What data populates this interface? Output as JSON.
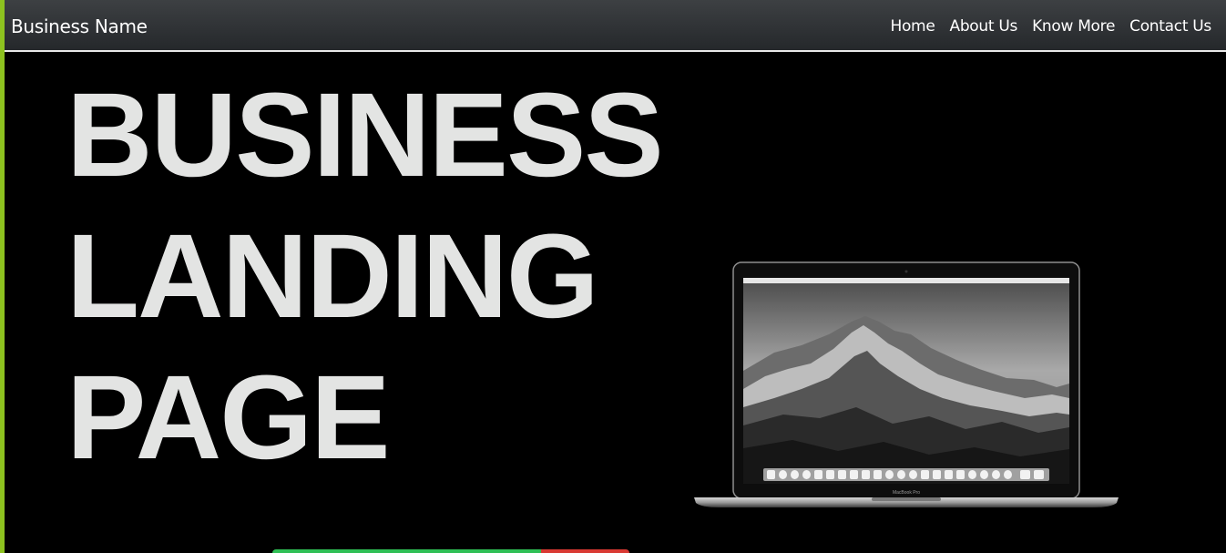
{
  "navbar": {
    "brand": "Business Name",
    "links": [
      "Home",
      "About Us",
      "Know More",
      "Contact Us"
    ]
  },
  "hero": {
    "title_lines": [
      "BUSINESS",
      "LANDING",
      "PAGE"
    ],
    "laptop_caption": "MacBook Pro"
  },
  "colors": {
    "accent_left": "#8dc21f",
    "background": "#000000",
    "title": "#e3e4e3",
    "navbar_top": "#3d4043",
    "navbar_bottom": "#25282b",
    "button_green": "#2fbf55",
    "button_red": "#d93a33"
  }
}
